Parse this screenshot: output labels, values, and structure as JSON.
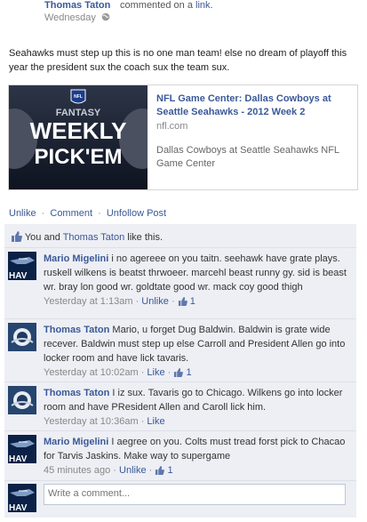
{
  "header": {
    "author": "Thomas Taton",
    "action_text": "commented on a",
    "action_link": "link",
    "action_end": ".",
    "timestamp": "Wednesday"
  },
  "post": {
    "text": "Seahawks must step up this is no one man team! else no dream of playoff this year the president sux the coach sux the team sux."
  },
  "share": {
    "thumb_brand": "NFL",
    "thumb_line1": "FANTASY",
    "thumb_line2": "WEEKLY",
    "thumb_line3": "PICK'EM",
    "title": "NFL Game Center: Dallas Cowboys at Seattle Seahawks - 2012 Week 2",
    "domain": "nfl.com",
    "description": "Dallas Cowboys at Seattle Seahawks NFL Game Center"
  },
  "actions": {
    "unlike": "Unlike",
    "comment": "Comment",
    "unfollow": "Unfollow Post",
    "sep": "·"
  },
  "likes": {
    "prefix": "You and",
    "person": "Thomas Taton",
    "suffix": "like this."
  },
  "comments": [
    {
      "author": "Mario Migelini",
      "text": "i no agereee on you taitn. seehawk have grate plays. ruskell wilkens is beatst thrwoeer. marcehl beast runny gy. sid is beast wr. bray lon good wr. goldtate good wr. mack coy good thigh",
      "time": "Yesterday at 1:13am",
      "action": "Unlike",
      "like_count": "1",
      "avatar": "seahawks-avatar"
    },
    {
      "author": "Thomas Taton",
      "text": "Mario, u forget Dug Baldwin. Baldwin is grate wide recever. Baldwin must step up else Carroll and President Allen go into locker room and have lick tavaris.",
      "time": "Yesterday at 10:02am",
      "action": "Like",
      "like_count": "1",
      "avatar": "cowboys-avatar"
    },
    {
      "author": "Thomas Taton",
      "text": "I iz sux. Tavaris go to Chicago. Wilkens go into locker room and have PResident Allen and Caroll lick him.",
      "time": "Yesterday at 10:36am",
      "action": "Like",
      "like_count": "",
      "avatar": "cowboys-avatar"
    },
    {
      "author": "Mario Migelini",
      "text": "I aegree on you. Colts must tread forst pick to Chacao for Tarvis Jaskins. Make way to supergame",
      "time": "45 minutes ago",
      "action": "Unlike",
      "like_count": "1",
      "avatar": "seahawks-avatar"
    }
  ],
  "write": {
    "placeholder": "Write a comment...",
    "avatar_label": "HAV"
  },
  "avatar_label": "HAV",
  "colors": {
    "link": "#3b5998",
    "comment_bg": "#edeff4"
  }
}
